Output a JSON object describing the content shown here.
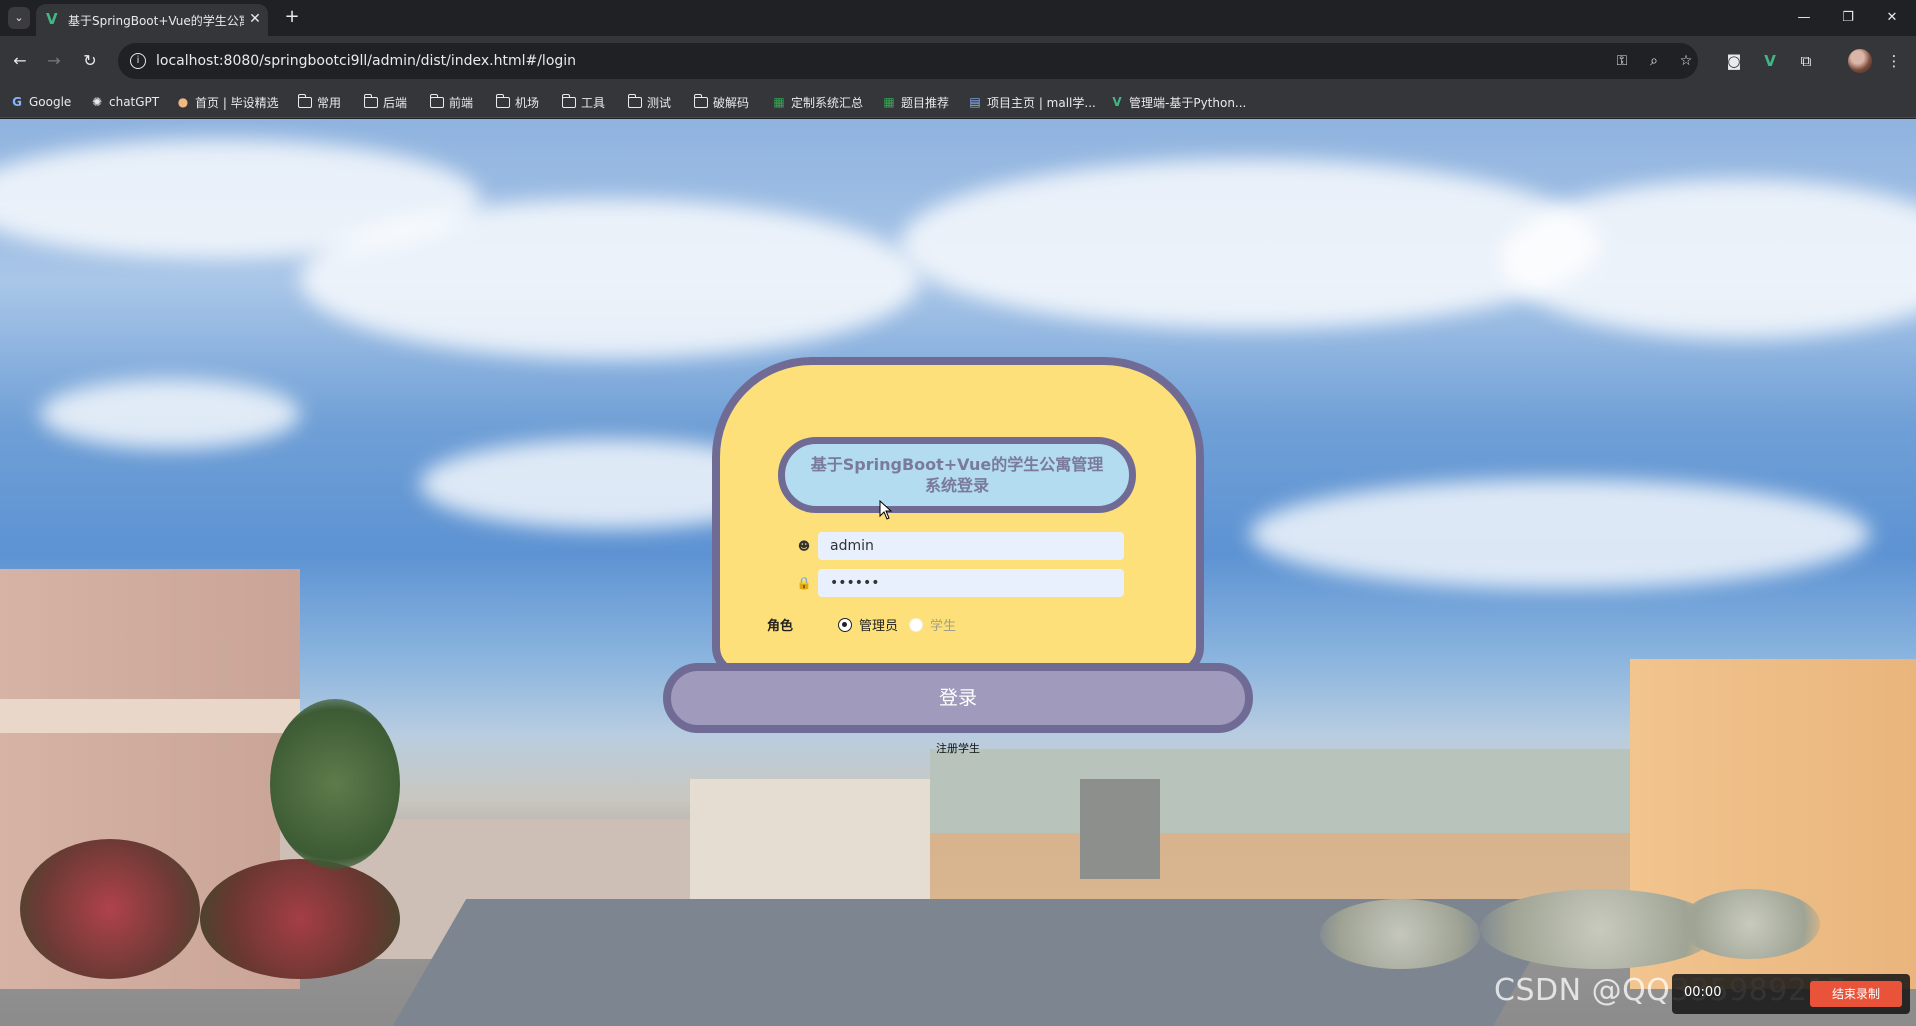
{
  "browser": {
    "tab_title": "基于SpringBoot+Vue的学生公寓管理系统",
    "url": "localhost:8080/springbootci9ll/admin/dist/index.html#/login",
    "bookmarks": [
      "Google",
      "chatGPT",
      "首页 | 毕设精选",
      "常用",
      "后端",
      "前端",
      "机场",
      "工具",
      "测试",
      "破解码",
      "定制系统汇总",
      "题目推荐",
      "项目主页 | mall学...",
      "管理端-基于Python..."
    ]
  },
  "login": {
    "title": "基于SpringBoot+Vue的学生公寓管理系统登录",
    "username_value": "admin",
    "password_value": "••••••",
    "role_label": "角色",
    "role_options": [
      "管理员",
      "学生"
    ],
    "role_selected": "管理员",
    "submit_label": "登录",
    "register_label": "注册学生"
  },
  "overlay": {
    "watermark": "CSDN @QQ335989217",
    "rec_time": "00:00",
    "rec_button": "结束录制"
  },
  "colors": {
    "card_fill": "#fde07a",
    "card_border": "#6f6b95",
    "title_fill": "#b3dcf0",
    "button_fill": "#a09bbd"
  }
}
